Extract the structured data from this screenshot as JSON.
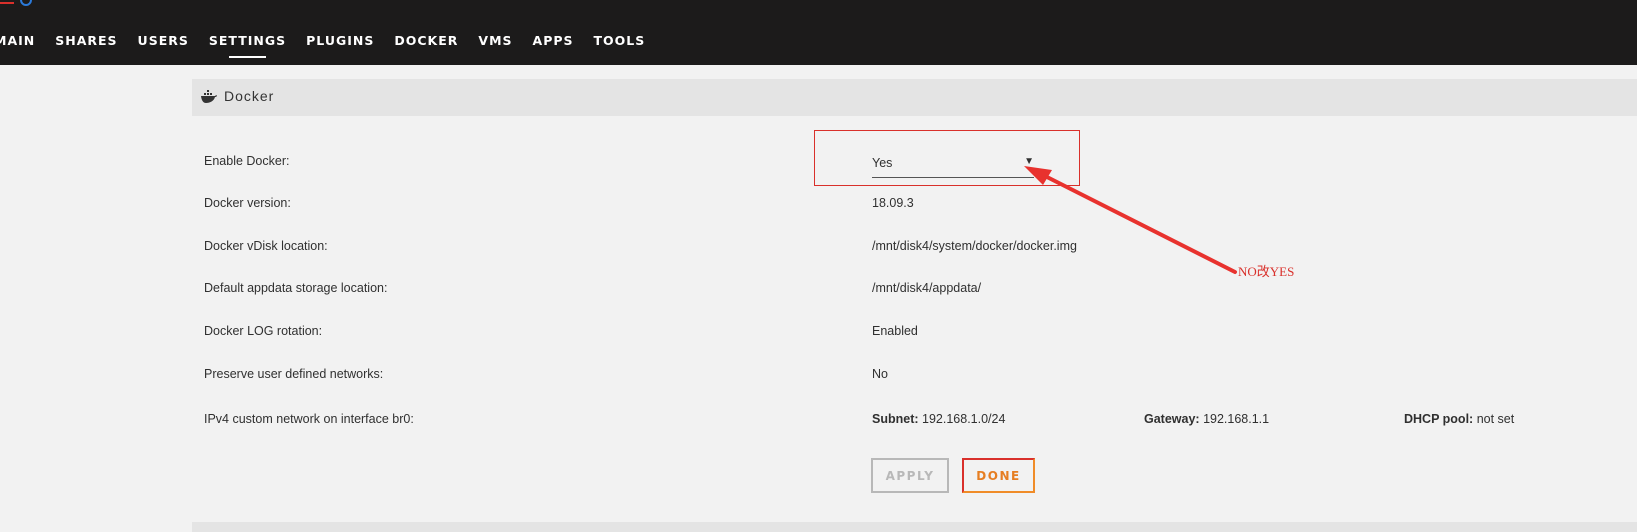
{
  "nav": {
    "items": [
      {
        "label": "MAIN"
      },
      {
        "label": "SHARES"
      },
      {
        "label": "USERS"
      },
      {
        "label": "SETTINGS",
        "active": true
      },
      {
        "label": "PLUGINS"
      },
      {
        "label": "DOCKER"
      },
      {
        "label": "VMS"
      },
      {
        "label": "APPS"
      },
      {
        "label": "TOOLS"
      }
    ]
  },
  "panel": {
    "title": "Docker",
    "icon": "docker-whale-icon"
  },
  "settings": {
    "enable_docker": {
      "label": "Enable Docker:",
      "value": "Yes"
    },
    "docker_version": {
      "label": "Docker version:",
      "value": "18.09.3"
    },
    "vdisk_location": {
      "label": "Docker vDisk location:",
      "value": "/mnt/disk4/system/docker/docker.img"
    },
    "appdata_location": {
      "label": "Default appdata storage location:",
      "value": "/mnt/disk4/appdata/"
    },
    "log_rotation": {
      "label": "Docker LOG rotation:",
      "value": "Enabled"
    },
    "preserve_networks": {
      "label": "Preserve user defined networks:",
      "value": "No"
    },
    "ipv4_network": {
      "label": "IPv4 custom network on interface br0:",
      "subnet_label": "Subnet:",
      "subnet_value": "192.168.1.0/24",
      "gateway_label": "Gateway:",
      "gateway_value": "192.168.1.1",
      "dhcp_label": "DHCP pool:",
      "dhcp_value": "not set"
    }
  },
  "buttons": {
    "apply": "APPLY",
    "done": "DONE"
  },
  "annotation": {
    "text": "NO改YES"
  },
  "colors": {
    "topbar": "#1c1b1b",
    "annotation_red": "#d9302b",
    "done_orange": "#e67e22"
  }
}
